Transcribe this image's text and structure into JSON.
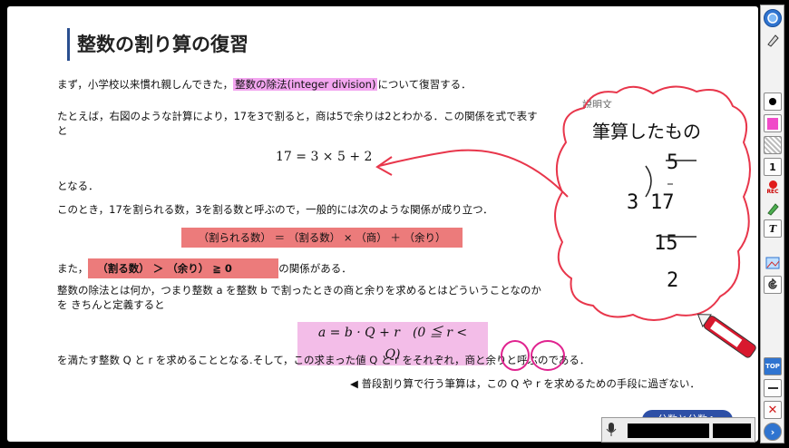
{
  "slide": {
    "title": "整数の割り算の復習",
    "para1_before": "まず，小学校以来慣れ親しんできた，",
    "para1_highlight": "整数の除法(integer division)",
    "para1_after": "について復習する．",
    "para2_line1": "たとえば，右図のような計算により，17を3で割ると，商は5で余りは2とわかる．この関係を式で表す",
    "para2_line2": "と",
    "equation1": "17 = 3 × 5 + 2",
    "naru": "となる．",
    "para3": "このとき，17を割られる数，3を割る数と呼ぶので，一般的には次のような関係が成り立つ．",
    "relation_box": "（割られる数） ＝ （割る数） × （商） ＋ （余り）",
    "also_prefix": "また，",
    "also_box": "（割る数） ＞ （余り） ≧ 0",
    "also_suffix": "の関係がある．",
    "para4_line1": "整数の除法とは何か，つまり整数 a を整数 b で割ったときの商と余りを求めるとはどういうことなのか",
    "para4_line2": "を きちんと定義すると",
    "equation2": "a = b · Q + r　(0 ≦ r < Q)",
    "para5_before": "を満たす整数 Q と r を求めることとなる.そして，この求まった値 Q と r をそれぞれ，",
    "para5_quotient": "商",
    "para5_mid": "と",
    "para5_remainder": "余り",
    "para5_after": "と呼ぶのである．",
    "para6": "◀ 普段割り算で行う筆算は，この Q や r を求めるための手段に過ぎない．",
    "note_label": "説明文",
    "figure": {
      "heading": "筆算したもの",
      "quotient": "5",
      "divisor": "3",
      "dividend": "17",
      "product": "15",
      "remainder": "2"
    }
  },
  "blue_button": "分数と分数へ",
  "toolbar": {
    "tools": [
      "circle-icon",
      "pen-select-icon",
      "dot-color-icon",
      "pink-color-icon",
      "grid-icon",
      "size-1-icon",
      "rec-icon",
      "pencil-icon",
      "text-icon",
      "image-icon",
      "undo-icon",
      "top-button",
      "minimize-icon",
      "close-icon",
      "next-icon"
    ],
    "size_label": "1",
    "rec_label": "REC",
    "text_label": "T",
    "top_label": "TOP"
  },
  "colors": {
    "accent_red": "#e8364b",
    "magenta_circle": "#e0238f",
    "highlight_magenta": "#f3a6f0",
    "box_red": "#ec7b7b",
    "box_pink": "#f3bde8",
    "title_bar": "#2a4f8f"
  }
}
